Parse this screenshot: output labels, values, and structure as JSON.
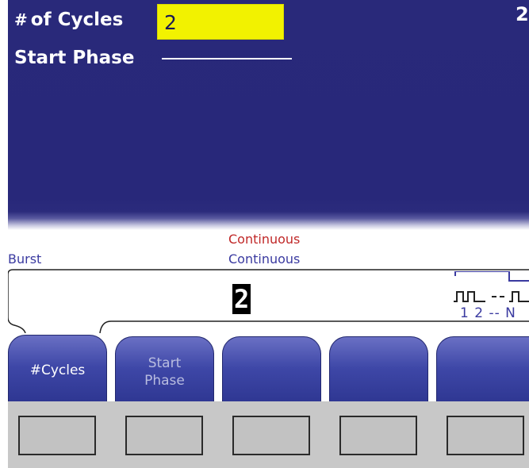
{
  "display": {
    "cycles_label": "of Cycles",
    "cycles_symbol": "#",
    "cycles_value": "2",
    "start_phase_label": "Start Phase",
    "corner_number": "2"
  },
  "status": {
    "trigger_mode": "Continuous",
    "trigger_mode_color": "#c02828",
    "burst_label": "Burst",
    "burst_mode": "Continuous",
    "burst_mode_color": "#3a3aa0",
    "edit_value": "2",
    "burst_icon_label": "1 2 -- N"
  },
  "softkeys": [
    {
      "line1": "#Cycles",
      "line2": "",
      "state": "active"
    },
    {
      "line1": "Start",
      "line2": "Phase",
      "state": "dim"
    },
    {
      "line1": "",
      "line2": "",
      "state": "blank"
    },
    {
      "line1": "",
      "line2": "",
      "state": "blank"
    },
    {
      "line1": "",
      "line2": "",
      "state": "blank"
    }
  ],
  "colors": {
    "display_bg": "#29297a",
    "field_highlight": "#f2f200",
    "softkey_blue": "#3e47a7"
  }
}
